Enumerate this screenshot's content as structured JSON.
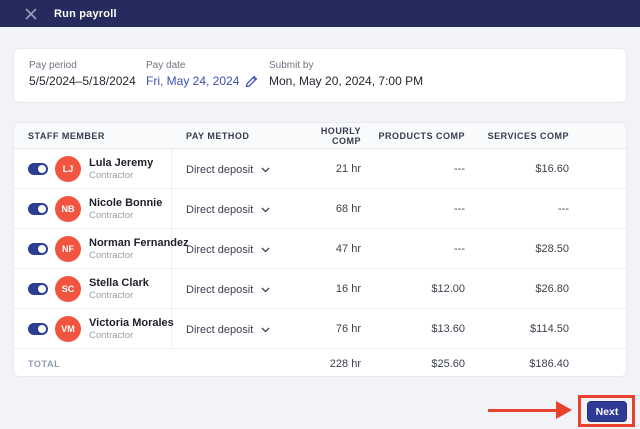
{
  "colors": {
    "header_bg": "#252b5c",
    "accent_indigo": "#2e3c94",
    "link_indigo": "#3f4eb5",
    "avatar_red": "#f2553f",
    "annotation_red": "#e8422c",
    "page_bg": "#f2f3f6"
  },
  "header": {
    "title": "Run payroll"
  },
  "summary": {
    "fields": [
      {
        "label": "Pay period",
        "value": "5/5/2024–5/18/2024"
      },
      {
        "label": "Pay date",
        "value": "Fri, May 24, 2024"
      },
      {
        "label": "Submit by",
        "value": "Mon, May 20, 2024, 7:00 PM"
      }
    ]
  },
  "table": {
    "columns": [
      "STAFF MEMBER",
      "PAY METHOD",
      "HOURLY COMP",
      "PRODUCTS COMP",
      "SERVICES COMP"
    ],
    "rows": [
      {
        "initials": "LJ",
        "name": "Lula Jeremy",
        "role": "Contractor",
        "pay_method": "Direct deposit",
        "hourly": "21 hr",
        "products": "---",
        "services": "$16.60",
        "enabled": true
      },
      {
        "initials": "NB",
        "name": "Nicole Bonnie",
        "role": "Contractor",
        "pay_method": "Direct deposit",
        "hourly": "68 hr",
        "products": "---",
        "services": "---",
        "enabled": true
      },
      {
        "initials": "NF",
        "name": "Norman Fernandez",
        "role": "Contractor",
        "pay_method": "Direct deposit",
        "hourly": "47 hr",
        "products": "---",
        "services": "$28.50",
        "enabled": true
      },
      {
        "initials": "SC",
        "name": "Stella Clark",
        "role": "Contractor",
        "pay_method": "Direct deposit",
        "hourly": "16 hr",
        "products": "$12.00",
        "services": "$26.80",
        "enabled": true
      },
      {
        "initials": "VM",
        "name": "Victoria Morales",
        "role": "Contractor",
        "pay_method": "Direct deposit",
        "hourly": "76 hr",
        "products": "$13.60",
        "services": "$114.50",
        "enabled": true
      }
    ],
    "total": {
      "label": "TOTAL",
      "hourly": "228 hr",
      "products": "$25.60",
      "services": "$186.40"
    }
  },
  "footer": {
    "next_label": "Next"
  }
}
